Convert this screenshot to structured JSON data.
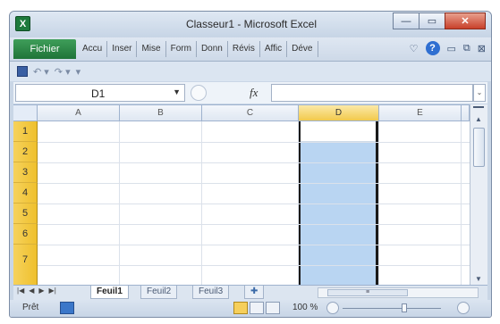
{
  "window": {
    "title": "Classeur1 - Microsoft Excel",
    "app_icon": "X"
  },
  "ribbon": {
    "file_tab": "Fichier",
    "tabs": [
      "Accu",
      "Inser",
      "Mise",
      "Form",
      "Donn",
      "Révis",
      "Affic",
      "Déve"
    ]
  },
  "formula_bar": {
    "name_box": "D1",
    "fx_label": "fx",
    "value": ""
  },
  "grid": {
    "columns": [
      "A",
      "B",
      "C",
      "D",
      "E"
    ],
    "rows": [
      "1",
      "2",
      "3",
      "4",
      "5",
      "6",
      "7"
    ],
    "selected_column": "D"
  },
  "sheets": [
    "Feuil1",
    "Feuil2",
    "Feuil3"
  ],
  "status": {
    "mode": "Prêt",
    "zoom": "100 %"
  },
  "icons": {
    "minimize": "minimize-icon",
    "maximize": "maximize-icon",
    "close": "close-icon",
    "help": "help-icon",
    "save": "save-icon",
    "undo": "undo-icon",
    "redo": "redo-icon"
  }
}
